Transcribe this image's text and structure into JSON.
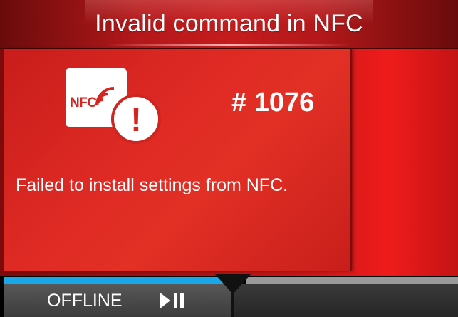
{
  "header": {
    "title": "Invalid command in NFC"
  },
  "message": {
    "icon": "nfc-error-icon",
    "nfc_badge_text": "NFC",
    "error_code": "# 1076",
    "text": "Failed to install settings from NFC."
  },
  "status_bar": {
    "mode_label": "OFFLINE",
    "mode_icon": "play-pause-icon"
  },
  "colors": {
    "title_bg": "#b3181a",
    "panel_bg": "#df2a24",
    "status_accent": "#1aa7e8",
    "status_bg": "#3c3c3c"
  }
}
